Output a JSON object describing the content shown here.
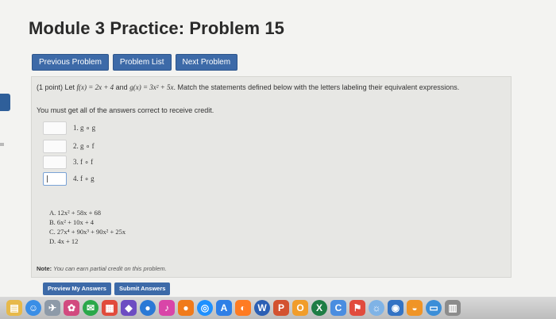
{
  "page": {
    "title": "Module 3 Practice: Problem 15"
  },
  "nav": {
    "previous": "Previous Problem",
    "list": "Problem List",
    "next": "Next Problem"
  },
  "problem": {
    "prompt_prefix": "(1 point) Let ",
    "f_def": "f(x) = 2x + 4",
    "and": " and ",
    "g_def": "g(x) = 3x² + 5x",
    "prompt_suffix": ". Match the statements defined below with the letters labeling their equivalent expressions.",
    "must_all": "You must get all of the answers correct to receive credit.",
    "questions": [
      {
        "label": "1. g ∘ g",
        "value": ""
      },
      {
        "label": "2. g ∘ f",
        "value": ""
      },
      {
        "label": "3. f ∘ f",
        "value": ""
      },
      {
        "label": "4. f ∘ g",
        "value": ""
      }
    ],
    "answers": [
      "A. 12x² + 58x + 68",
      "B. 6x² + 10x + 4",
      "C. 27x⁴ + 90x³ + 90x² + 25x",
      "D. 4x + 12"
    ],
    "note_label": "Note:",
    "note_text": " You can earn partial credit on this problem."
  },
  "actions": {
    "preview": "Preview My Answers",
    "submit": "Submit Answers"
  },
  "colors": {
    "accent": "#3d6aa8",
    "page_bg": "#f3f3f1",
    "panel_bg": "#e7e7e4"
  },
  "dock": {
    "icons": [
      {
        "name": "notes-app-icon",
        "color": "#e7b94a",
        "glyph": "▤"
      },
      {
        "name": "finder-icon",
        "color": "#3a8ee6",
        "glyph": "☺"
      },
      {
        "name": "launchpad-icon",
        "color": "#8d9aa8",
        "glyph": "✈"
      },
      {
        "name": "photos-app-icon",
        "color": "#d24a7f",
        "glyph": "✿"
      },
      {
        "name": "chat-app-icon",
        "color": "#2aa84a",
        "glyph": "✉"
      },
      {
        "name": "calendar-app-icon",
        "color": "#e14b3c",
        "glyph": "▦"
      },
      {
        "name": "game-center-icon",
        "color": "#6d4cc2",
        "glyph": "◆"
      },
      {
        "name": "blue-round-app-icon",
        "color": "#2a79d6",
        "glyph": "●"
      },
      {
        "name": "itunes-icon",
        "color": "#d945a8",
        "glyph": "♪"
      },
      {
        "name": "orange-round-app-icon",
        "color": "#f07a1a",
        "glyph": "●"
      },
      {
        "name": "safari-icon",
        "color": "#1e90ff",
        "glyph": "◎"
      },
      {
        "name": "app-store-icon",
        "color": "#2f7fe6",
        "glyph": "A"
      },
      {
        "name": "firefox-icon",
        "color": "#ff7b22",
        "glyph": "◐"
      },
      {
        "name": "word-icon",
        "color": "#2b5fb4",
        "glyph": "W"
      },
      {
        "name": "powerpoint-icon",
        "color": "#d35230",
        "glyph": "P"
      },
      {
        "name": "onenote-icon",
        "color": "#f19d2a",
        "glyph": "O"
      },
      {
        "name": "excel-icon",
        "color": "#1e7d45",
        "glyph": "X"
      },
      {
        "name": "chrome-icon",
        "color": "#4a8de0",
        "glyph": "C"
      },
      {
        "name": "maps-app-icon",
        "color": "#e14b3c",
        "glyph": "⚑"
      },
      {
        "name": "preview-app-icon",
        "color": "#7fb3e6",
        "glyph": "☼"
      },
      {
        "name": "quicktime-icon",
        "color": "#3373c4",
        "glyph": "◉"
      },
      {
        "name": "cleanup-app-icon",
        "color": "#f09426",
        "glyph": "◒"
      },
      {
        "name": "system-app-icon",
        "color": "#3b8ed8",
        "glyph": "▭"
      },
      {
        "name": "trash-icon",
        "color": "#8c8c8c",
        "glyph": "▥"
      }
    ]
  }
}
